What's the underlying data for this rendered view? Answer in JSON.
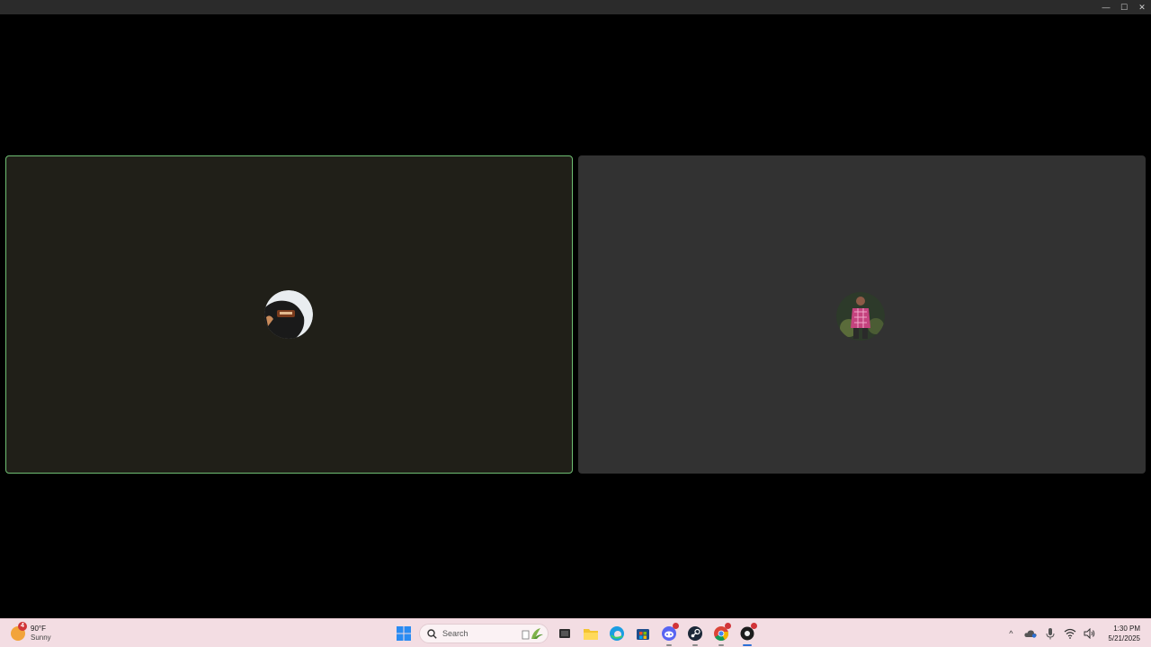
{
  "window": {
    "controls": {
      "minimize": "—",
      "maximize": "☐",
      "close": "✕"
    }
  },
  "call": {
    "participants": [
      {
        "avatar_icon": "avatar-dark-person-icon",
        "speaking": true,
        "border_color": "#6fbf73"
      },
      {
        "avatar_icon": "avatar-plaid-shirt-person-icon",
        "speaking": false
      }
    ]
  },
  "taskbar": {
    "weather": {
      "badge": "4",
      "temperature": "90°F",
      "condition": "Sunny"
    },
    "search": {
      "placeholder": "Search"
    },
    "apps": [
      "start-icon",
      "search-icon",
      "task-view-icon",
      "file-explorer-icon",
      "edge-icon",
      "store-icon",
      "discord-icon",
      "steam-icon",
      "chrome-icon",
      "app-icon"
    ],
    "tray": {
      "chevron": "^",
      "time": "1:30 PM",
      "date": "5/21/2025"
    }
  },
  "colors": {
    "accent": "#2a6fd6",
    "speaking_border": "#6fbf73",
    "taskbar_bg": "#f3dde3"
  }
}
